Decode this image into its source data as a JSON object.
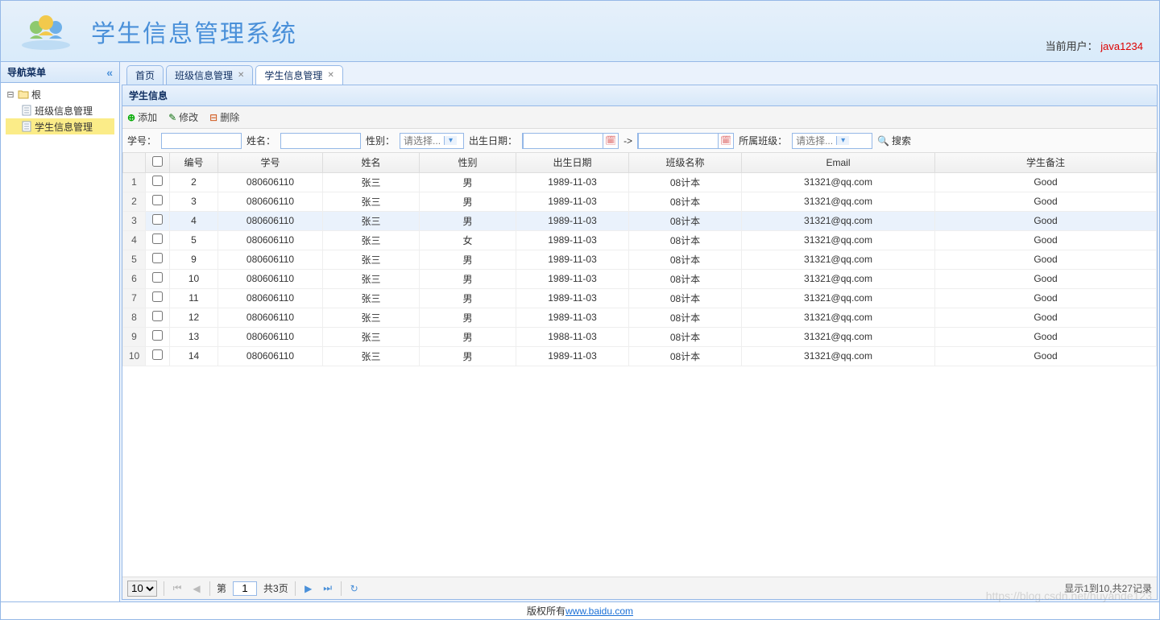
{
  "header": {
    "title": "学生信息管理系统",
    "user_label": "当前用户：",
    "username": "java1234"
  },
  "sidebar": {
    "title": "导航菜单",
    "root": "根",
    "items": [
      {
        "label": "班级信息管理"
      },
      {
        "label": "学生信息管理"
      }
    ]
  },
  "tabs": [
    {
      "label": "首页",
      "closable": false
    },
    {
      "label": "班级信息管理",
      "closable": true
    },
    {
      "label": "学生信息管理",
      "closable": true
    }
  ],
  "panel": {
    "title": "学生信息"
  },
  "toolbar": {
    "add": "添加",
    "edit": "修改",
    "del": "删除"
  },
  "search": {
    "sno_label": "学号：",
    "name_label": "姓名：",
    "gender_label": "性别：",
    "gender_placeholder": "请选择...",
    "birth_label": "出生日期：",
    "to": "->",
    "class_label": "所属班级：",
    "class_placeholder": "请选择...",
    "btn": "搜索"
  },
  "columns": [
    "",
    "",
    "编号",
    "学号",
    "姓名",
    "性别",
    "出生日期",
    "班级名称",
    "Email",
    "学生备注"
  ],
  "rows": [
    {
      "n": 1,
      "id": "2",
      "sno": "080606110",
      "name": "张三",
      "gender": "男",
      "birth": "1989-11-03",
      "class": "08计本",
      "email": "31321@qq.com",
      "remark": "Good"
    },
    {
      "n": 2,
      "id": "3",
      "sno": "080606110",
      "name": "张三",
      "gender": "男",
      "birth": "1989-11-03",
      "class": "08计本",
      "email": "31321@qq.com",
      "remark": "Good"
    },
    {
      "n": 3,
      "id": "4",
      "sno": "080606110",
      "name": "张三",
      "gender": "男",
      "birth": "1989-11-03",
      "class": "08计本",
      "email": "31321@qq.com",
      "remark": "Good",
      "hl": true
    },
    {
      "n": 4,
      "id": "5",
      "sno": "080606110",
      "name": "张三",
      "gender": "女",
      "birth": "1989-11-03",
      "class": "08计本",
      "email": "31321@qq.com",
      "remark": "Good"
    },
    {
      "n": 5,
      "id": "9",
      "sno": "080606110",
      "name": "张三",
      "gender": "男",
      "birth": "1989-11-03",
      "class": "08计本",
      "email": "31321@qq.com",
      "remark": "Good"
    },
    {
      "n": 6,
      "id": "10",
      "sno": "080606110",
      "name": "张三",
      "gender": "男",
      "birth": "1989-11-03",
      "class": "08计本",
      "email": "31321@qq.com",
      "remark": "Good"
    },
    {
      "n": 7,
      "id": "11",
      "sno": "080606110",
      "name": "张三",
      "gender": "男",
      "birth": "1989-11-03",
      "class": "08计本",
      "email": "31321@qq.com",
      "remark": "Good"
    },
    {
      "n": 8,
      "id": "12",
      "sno": "080606110",
      "name": "张三",
      "gender": "男",
      "birth": "1989-11-03",
      "class": "08计本",
      "email": "31321@qq.com",
      "remark": "Good"
    },
    {
      "n": 9,
      "id": "13",
      "sno": "080606110",
      "name": "张三",
      "gender": "男",
      "birth": "1988-11-03",
      "class": "08计本",
      "email": "31321@qq.com",
      "remark": "Good"
    },
    {
      "n": 10,
      "id": "14",
      "sno": "080606110",
      "name": "张三",
      "gender": "男",
      "birth": "1989-11-03",
      "class": "08计本",
      "email": "31321@qq.com",
      "remark": "Good"
    }
  ],
  "pagination": {
    "page_size": "10",
    "page_label_prefix": "第",
    "page": "1",
    "total_pages_label": "共3页",
    "info": "显示1到10,共27记录"
  },
  "footer": {
    "text": "版权所有",
    "link": "www.baidu.com"
  },
  "watermark": "https://blog.csdn.net/huyande123"
}
